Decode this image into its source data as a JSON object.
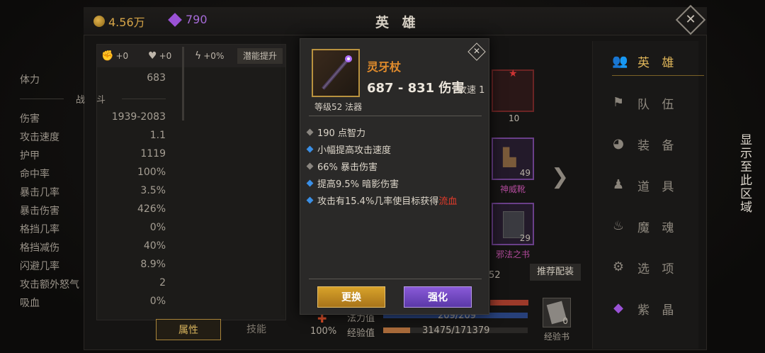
{
  "topbar": {
    "gold": "4.56万",
    "gems": "790",
    "title": "英 雄"
  },
  "left_panel": {
    "header": {
      "str": "+0",
      "hp": "+0",
      "spd": "+0%",
      "potential_button": "潜能提升"
    },
    "top_stat": {
      "label": "体力",
      "value": "683"
    },
    "section_title": "战 斗",
    "stats": [
      {
        "label": "伤害",
        "value": "1939-2083"
      },
      {
        "label": "攻击速度",
        "value": "1.1"
      },
      {
        "label": "护甲",
        "value": "1119"
      },
      {
        "label": "命中率",
        "value": "100%"
      },
      {
        "label": "暴击几率",
        "value": "3.5%"
      },
      {
        "label": "暴击伤害",
        "value": "426%"
      },
      {
        "label": "格挡几率",
        "value": "0%"
      },
      {
        "label": "格挡减伤",
        "value": "40%"
      },
      {
        "label": "闪避几率",
        "value": "8.9%"
      },
      {
        "label": "攻击额外怒气",
        "value": "2"
      },
      {
        "label": "吸血",
        "value": "0%"
      }
    ],
    "tabs": {
      "attributes": "属性",
      "skills": "技能"
    }
  },
  "middle": {
    "slot_top_num": "10",
    "slot_boots": {
      "num": "49",
      "name": "神威靴"
    },
    "slot_book": {
      "num": "29",
      "name": "邪法之书"
    },
    "partial_52": "52",
    "recommend_button": "推荐配装",
    "percent": "100%",
    "mana": {
      "label": "法力值",
      "value": "209/209"
    },
    "xp": {
      "label": "经验值",
      "value": "31475/171379",
      "fill_fraction": 0.184
    },
    "xp_book": {
      "label": "经验书",
      "count": "0"
    }
  },
  "right_nav": [
    {
      "label": "英 雄",
      "icon": "hero-icon",
      "active": true
    },
    {
      "label": "队 伍",
      "icon": "flag-icon",
      "active": false
    },
    {
      "label": "装 备",
      "icon": "helmet-icon",
      "active": false
    },
    {
      "label": "道 具",
      "icon": "bag-icon",
      "active": false
    },
    {
      "label": "魔 魂",
      "icon": "flame-icon",
      "active": false
    },
    {
      "label": "选 项",
      "icon": "gear-icon",
      "active": false
    },
    {
      "label": "紫 晶",
      "icon": "crystal-icon",
      "active": false
    }
  ],
  "side_text": "显示至此区域",
  "popup": {
    "item_name": "灵牙杖",
    "damage": "687 - 831 伤害",
    "attack_speed": "攻速 1",
    "level_type": "等级52 法器",
    "affixes": [
      {
        "text": "190 点智力",
        "color": "#8a8680"
      },
      {
        "text": "小幅提高攻击速度",
        "color": "#3a8fe6"
      },
      {
        "text": "66% 暴击伤害",
        "color": "#8a8680"
      },
      {
        "text": "提高9.5% 暗影伤害",
        "color": "#3a8fe6"
      },
      {
        "text_a": "攻击有15.4%几率使目标获得",
        "text_b": "流血",
        "color": "#3a8fe6"
      }
    ],
    "replace_button": "更换",
    "enhance_button": "强化"
  }
}
